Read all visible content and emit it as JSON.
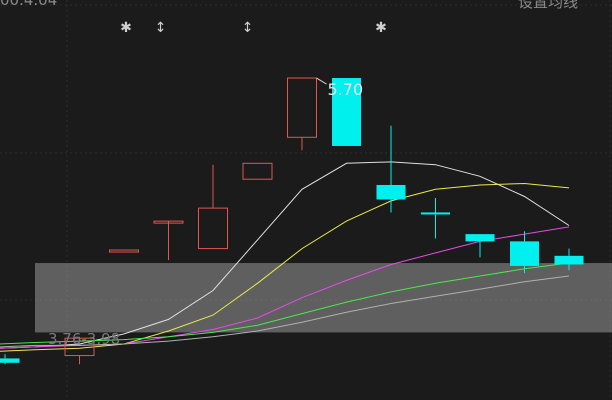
{
  "header": {
    "price_fragment": "00.4.04",
    "settings_button": "设置均线"
  },
  "chart_data": {
    "type": "candlestick",
    "title": "",
    "xlabel": "",
    "ylabel": "",
    "ylim": [
      3.7,
      5.9
    ],
    "grid": true,
    "colors": {
      "up": "#e2564d",
      "down": "#00f0f0",
      "background": "#1b1b1b"
    },
    "candles": [
      {
        "open": 3.78,
        "high": 3.81,
        "low": 3.74,
        "close": 3.75
      },
      {
        "open": 3.8,
        "high": 3.93,
        "low": 3.74,
        "close": 3.92
      },
      {
        "open": 4.53,
        "high": 4.53,
        "low": 4.53,
        "close": 4.53
      },
      {
        "open": 4.73,
        "high": 4.73,
        "low": 4.46,
        "close": 4.73
      },
      {
        "open": 4.54,
        "high": 5.12,
        "low": 4.54,
        "close": 4.82
      },
      {
        "open": 5.02,
        "high": 5.13,
        "low": 5.02,
        "close": 5.13
      },
      {
        "open": 5.31,
        "high": 5.72,
        "low": 5.22,
        "close": 5.72
      },
      {
        "open": 5.72,
        "high": 5.72,
        "low": 5.25,
        "close": 5.25
      },
      {
        "open": 4.98,
        "high": 5.39,
        "low": 4.79,
        "close": 4.88
      },
      {
        "open": 4.79,
        "high": 4.89,
        "low": 4.61,
        "close": 4.78
      },
      {
        "open": 4.64,
        "high": 4.64,
        "low": 4.48,
        "close": 4.59
      },
      {
        "open": 4.59,
        "high": 4.66,
        "low": 4.37,
        "close": 4.42
      },
      {
        "open": 4.49,
        "high": 4.54,
        "low": 4.39,
        "close": 4.43
      }
    ],
    "series": [
      {
        "color": "#e0e0e0",
        "values": [
          3.86,
          3.88,
          3.95,
          4.05,
          4.25,
          4.6,
          4.95,
          5.13,
          5.14,
          5.12,
          5.04,
          4.9,
          4.7
        ]
      },
      {
        "color": "#eaea4a",
        "values": [
          3.84,
          3.85,
          3.88,
          3.97,
          4.08,
          4.3,
          4.54,
          4.73,
          4.87,
          4.95,
          4.98,
          4.99,
          4.96
        ]
      },
      {
        "color": "#e84ae8",
        "values": [
          3.86,
          3.87,
          3.88,
          3.93,
          3.98,
          4.06,
          4.2,
          4.32,
          4.43,
          4.51,
          4.59,
          4.64,
          4.69
        ]
      },
      {
        "color": "#4ae84a",
        "values": [
          3.89,
          3.9,
          3.91,
          3.93,
          3.96,
          4.01,
          4.09,
          4.17,
          4.24,
          4.3,
          4.35,
          4.4,
          4.44
        ]
      },
      {
        "color": "#b0b0b0",
        "values": [
          3.87,
          3.87,
          3.88,
          3.9,
          3.93,
          3.97,
          4.03,
          4.1,
          4.16,
          4.21,
          4.26,
          4.31,
          4.35
        ]
      }
    ],
    "annotations": {
      "high_label": "5.70",
      "range_label": "3.76-3.98"
    }
  }
}
